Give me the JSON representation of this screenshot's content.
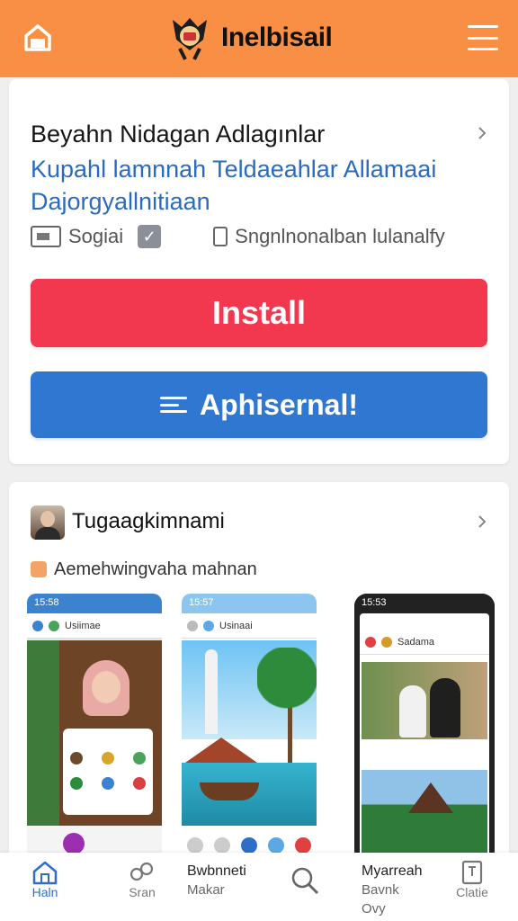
{
  "header": {
    "brand_title": "Inelbisail",
    "accent_color": "#f98f45",
    "icons": [
      "home-icon",
      "logo-emblem",
      "menu-icon"
    ]
  },
  "app_card": {
    "title": "Beyahn Nidagan Adlagınlar",
    "subtitle": "Kupahl lamnnah Teldaeahlar Allamaai Dajorgyallnitiaan",
    "meta_left": "Sogiai",
    "meta_right": "Sngnlnonalban lulanalfy",
    "install_label": "Install",
    "secondary_label": "Aphisernal!",
    "install_color": "#f2384f",
    "secondary_color": "#2f77d0"
  },
  "feed_card": {
    "title": "Tugaagkimnami",
    "note": "Aemehwingvaha mahnan",
    "screenshots": [
      {
        "status_time": "15:58",
        "app_label": "Usiimae"
      },
      {
        "status_time": "15:57",
        "app_label": "Usinaai"
      },
      {
        "status_time": "15:53",
        "app_label": "Sadama"
      }
    ]
  },
  "bottom_nav": {
    "home_label": "Haln",
    "start_label": "Sran",
    "text1_line1": "Bwbnneti",
    "text1_line2": "Makar",
    "text2_line1": "Myarreah",
    "text2_line2": "Bavnk",
    "text2_line3": "Ovy",
    "list_label": "Clatie"
  }
}
